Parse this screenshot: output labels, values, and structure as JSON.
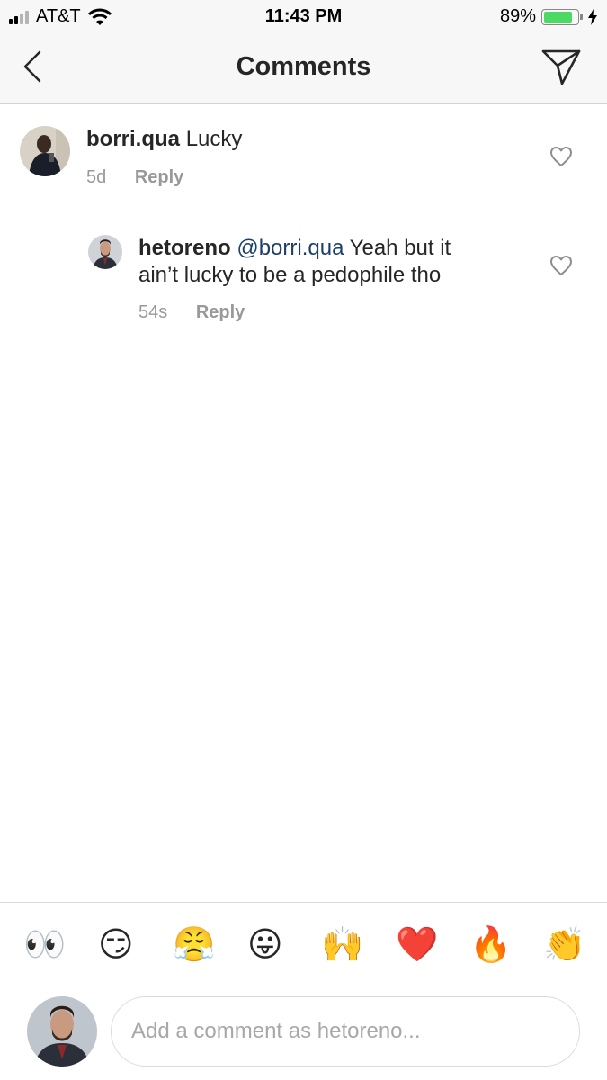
{
  "status_bar": {
    "carrier": "AT&T",
    "time": "11:43 PM",
    "battery_percent": "89%",
    "battery_level": 0.89,
    "signal_bars_active": 2,
    "wifi_icon": "wifi-icon",
    "charging_icon": "bolt-icon"
  },
  "nav": {
    "title": "Comments",
    "back_icon": "chevron-left-icon",
    "send_icon": "paper-plane-icon"
  },
  "comments": [
    {
      "username": "borri.qua",
      "mention": "",
      "text": "Lucky",
      "time": "5d",
      "reply_label": "Reply",
      "like_icon": "heart-outline-icon"
    },
    {
      "username": "hetoreno",
      "mention": "@borri.qua",
      "text_line1": "Yeah but it",
      "text_line2": "ain’t lucky to be a pedophile tho",
      "time": "54s",
      "reply_label": "Reply",
      "like_icon": "heart-outline-icon"
    }
  ],
  "emoji_bar": [
    "👀",
    "😏",
    "😤",
    "😛",
    "🙌",
    "❤️",
    "🔥",
    "👏"
  ],
  "composer": {
    "placeholder": "Add a comment as hetoreno...",
    "value": ""
  },
  "colors": {
    "mention": "#1f3f6b",
    "muted": "#999999",
    "battery": "#4cd964"
  }
}
